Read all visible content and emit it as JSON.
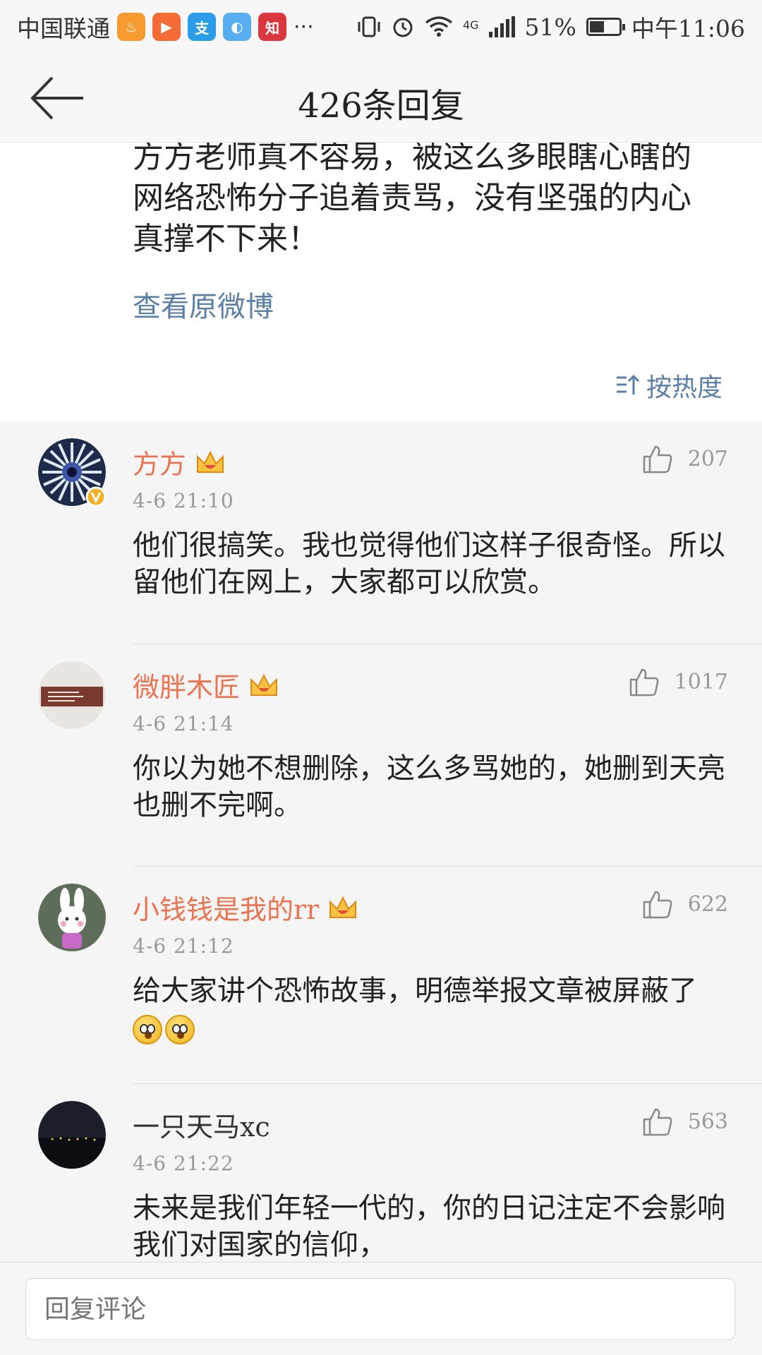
{
  "status_bar": {
    "carrier": "中国联通",
    "apps": [
      {
        "icon": "app-icon-orange",
        "color": "#f59b30",
        "glyph": "♨"
      },
      {
        "icon": "video-app-icon",
        "color": "#f36c37",
        "glyph": "▶"
      },
      {
        "icon": "alipay-icon",
        "color": "#2a9ce8",
        "glyph": "支"
      },
      {
        "icon": "browser-icon",
        "color": "#58aef0",
        "glyph": "◐"
      },
      {
        "icon": "zhiwang-icon",
        "color": "#d9363e",
        "glyph": "知"
      }
    ],
    "more": "···",
    "network": "4G",
    "battery": "51%",
    "battery_level": 0.51,
    "time": "中午11:06"
  },
  "header": {
    "title": "426条回复"
  },
  "post": {
    "text": "方方老师真不容易，被这么多眼瞎心瞎的网络恐怖分子追着责骂，没有坚强的内心真撑不下来！",
    "view_original": "查看原微博",
    "sort_label": "按热度"
  },
  "comments": [
    {
      "username": "方方",
      "verified": true,
      "crown": true,
      "time": "4-6 21:10",
      "likes": "207",
      "text": "他们很搞笑。我也觉得他们这样子很奇怪。所以留他们在网上，大家都可以欣赏。"
    },
    {
      "username": "微胖木匠",
      "verified": false,
      "crown": true,
      "time": "4-6 21:14",
      "likes": "1017",
      "text": "你以为她不想删除，这么多骂她的，她删到天亮也删不完啊。"
    },
    {
      "username": "小钱钱是我的rr",
      "verified": false,
      "crown": true,
      "time": "4-6 21:12",
      "likes": "622",
      "text": "给大家讲个恐怖故事，明德举报文章被屏蔽了"
    },
    {
      "username": "一只天马xc",
      "verified": false,
      "crown": false,
      "time": "4-6 21:22",
      "likes": "563",
      "text": "未来是我们年轻一代的，你的日记注定不会影响我们对国家的信仰，"
    }
  ],
  "reply_bar": {
    "placeholder": "回复评论"
  },
  "colors": {
    "username": "#eb7350",
    "link": "#5b7fa6",
    "meta": "#999999"
  }
}
